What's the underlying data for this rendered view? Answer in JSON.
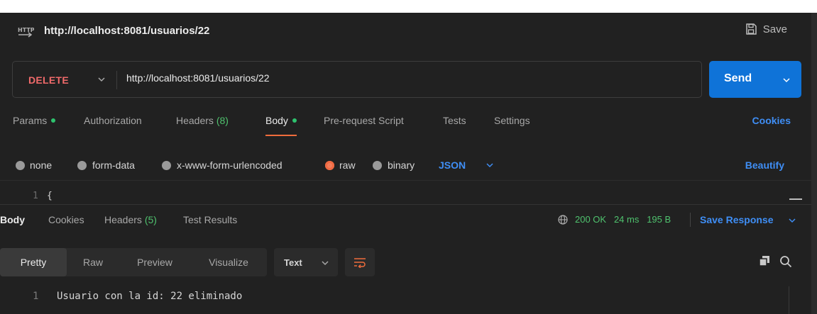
{
  "request": {
    "title": "http://localhost:8081/usuarios/22",
    "save_label": "Save",
    "method": "DELETE",
    "url": "http://localhost:8081/usuarios/22",
    "send_label": "Send"
  },
  "request_tabs": {
    "params": "Params",
    "authorization": "Authorization",
    "headers": "Headers",
    "headers_count": "(8)",
    "body": "Body",
    "pre_request": "Pre-request Script",
    "tests": "Tests",
    "settings": "Settings",
    "cookies": "Cookies",
    "active": "Body"
  },
  "body_types": {
    "options": [
      "none",
      "form-data",
      "x-www-form-urlencoded",
      "raw",
      "binary"
    ],
    "selected": "raw",
    "format": "JSON",
    "beautify": "Beautify"
  },
  "editor": {
    "line_number": "1",
    "content": "{"
  },
  "response_tabs": {
    "body": "Body",
    "cookies": "Cookies",
    "headers": "Headers",
    "headers_count": "(5)",
    "test_results": "Test Results"
  },
  "response_meta": {
    "status": "200 OK",
    "time": "24 ms",
    "size": "195 B",
    "save_response": "Save Response"
  },
  "response_toolbar": {
    "views": [
      "Pretty",
      "Raw",
      "Preview",
      "Visualize"
    ],
    "active_view": "Pretty",
    "format": "Text"
  },
  "response_body": {
    "line_number": "1",
    "text": "Usuario con la id: 22 eliminado"
  },
  "colors": {
    "background": "#212121",
    "accent_blue": "#0f73d8",
    "link_blue": "#3f8ef5",
    "method_red": "#f06a6a",
    "status_green": "#4fc26e",
    "active_underline": "#ef6c3c"
  }
}
